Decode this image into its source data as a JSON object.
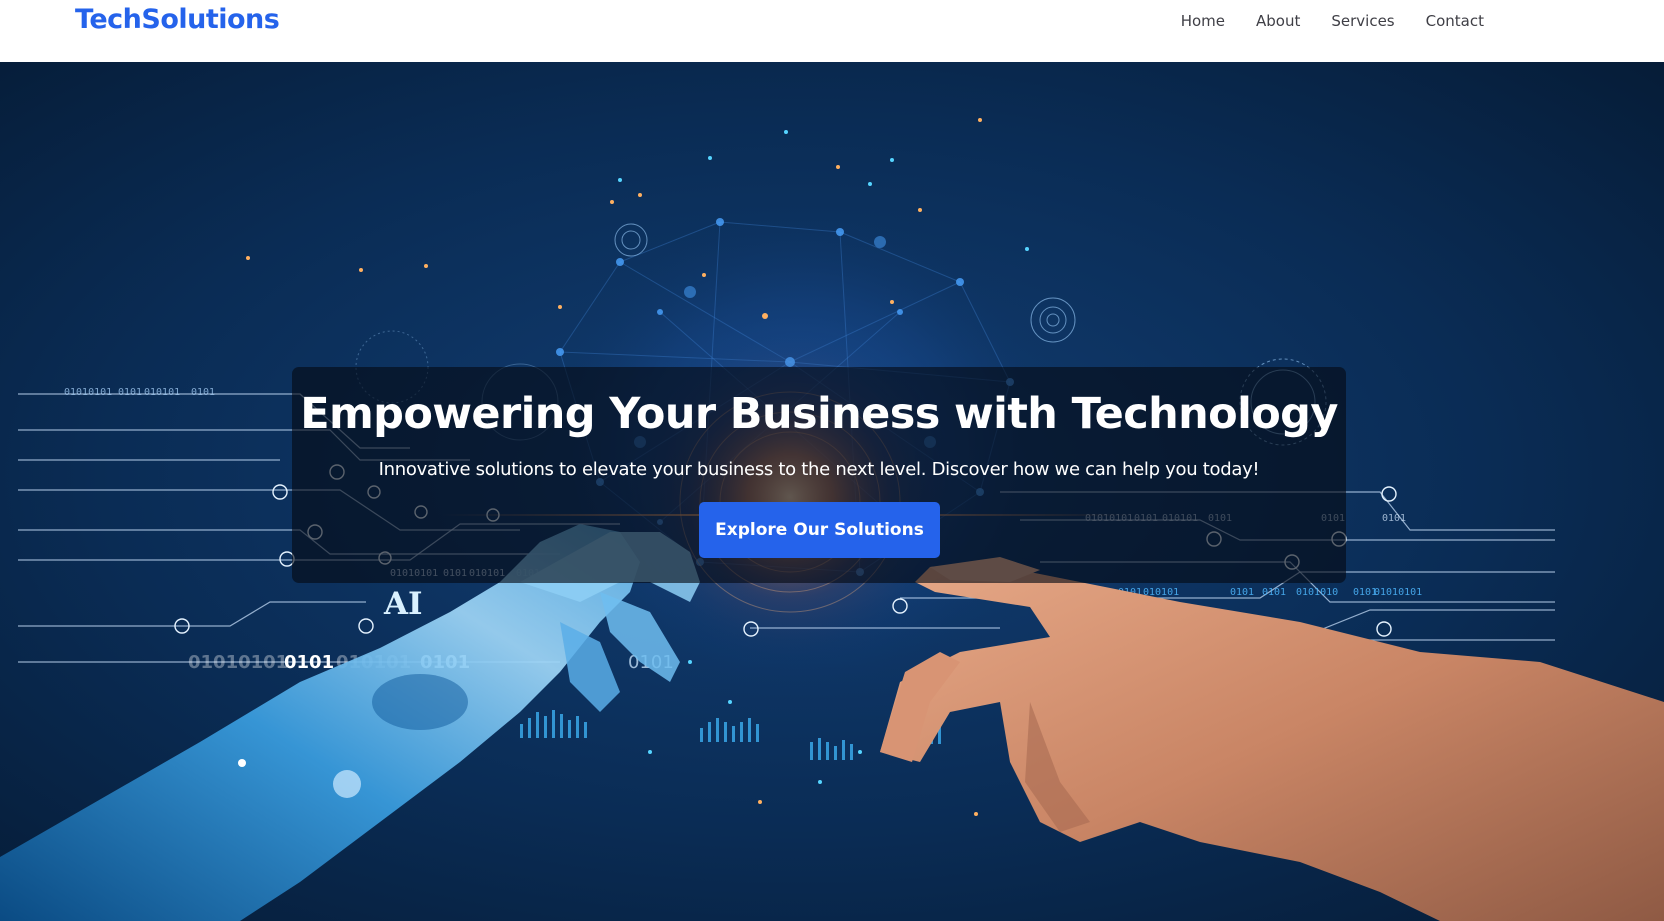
{
  "brand": {
    "name": "TechSolutions",
    "color": "#2563eb"
  },
  "nav": {
    "items": [
      {
        "label": "Home"
      },
      {
        "label": "About"
      },
      {
        "label": "Services"
      },
      {
        "label": "Contact"
      }
    ]
  },
  "hero": {
    "title": "Empowering Your Business with Technology",
    "subtitle": "Innovative solutions to elevate your business to the next level. Discover how we can help you today!",
    "cta_label": "Explore Our Solutions",
    "cta_color": "#2563eb",
    "image": {
      "ai_label": "AI",
      "binary_left": [
        "01010101",
        "0101",
        "010101",
        "0101"
      ],
      "binary_left_small": [
        "01010101",
        "0101",
        "010101",
        "0101"
      ],
      "binary_center": "0101",
      "binary_right": [
        "01010101",
        "0101",
        "010101",
        "0101",
        "0101"
      ],
      "binary_right_small": [
        "01010101",
        "0101",
        "010101",
        "0101",
        "0101",
        "0101"
      ],
      "binary_row_small": [
        "01010101",
        "0101",
        "010101",
        "0101",
        "0101",
        "0101010",
        "0101",
        "01010101"
      ],
      "binary_top_left": [
        "01010101",
        "0101",
        "010101",
        "0101"
      ]
    }
  }
}
